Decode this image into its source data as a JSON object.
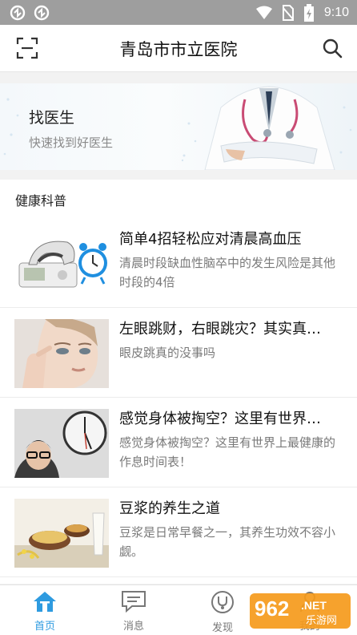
{
  "status": {
    "time": "9:10"
  },
  "header": {
    "title": "青岛市市立医院"
  },
  "banner": {
    "title": "找医生",
    "subtitle": "快速找到好医生"
  },
  "health": {
    "heading": "健康科普",
    "articles": [
      {
        "title": "简单4招轻松应对清晨高血压",
        "desc": "清晨时段缺血性脑卒中的发生风险是其他时段的4倍"
      },
      {
        "title": "左眼跳财，右眼跳灾？其实真…",
        "desc": "眼皮跳真的没事吗"
      },
      {
        "title": "感觉身体被掏空？这里有世界…",
        "desc": "感觉身体被掏空？这里有世界上最健康的作息时间表！"
      },
      {
        "title": "豆浆的养生之道",
        "desc": "豆浆是日常早餐之一，其养生功效不容小觑。"
      }
    ]
  },
  "tabs": [
    {
      "label": "首页"
    },
    {
      "label": "消息"
    },
    {
      "label": "发现"
    },
    {
      "label": "我的"
    }
  ],
  "watermark": {
    "brand": "962",
    "suffix": ".NET",
    "site": "乐游网"
  },
  "colors": {
    "accent": "#2e9be0",
    "statusbar": "#9e9e9e"
  }
}
